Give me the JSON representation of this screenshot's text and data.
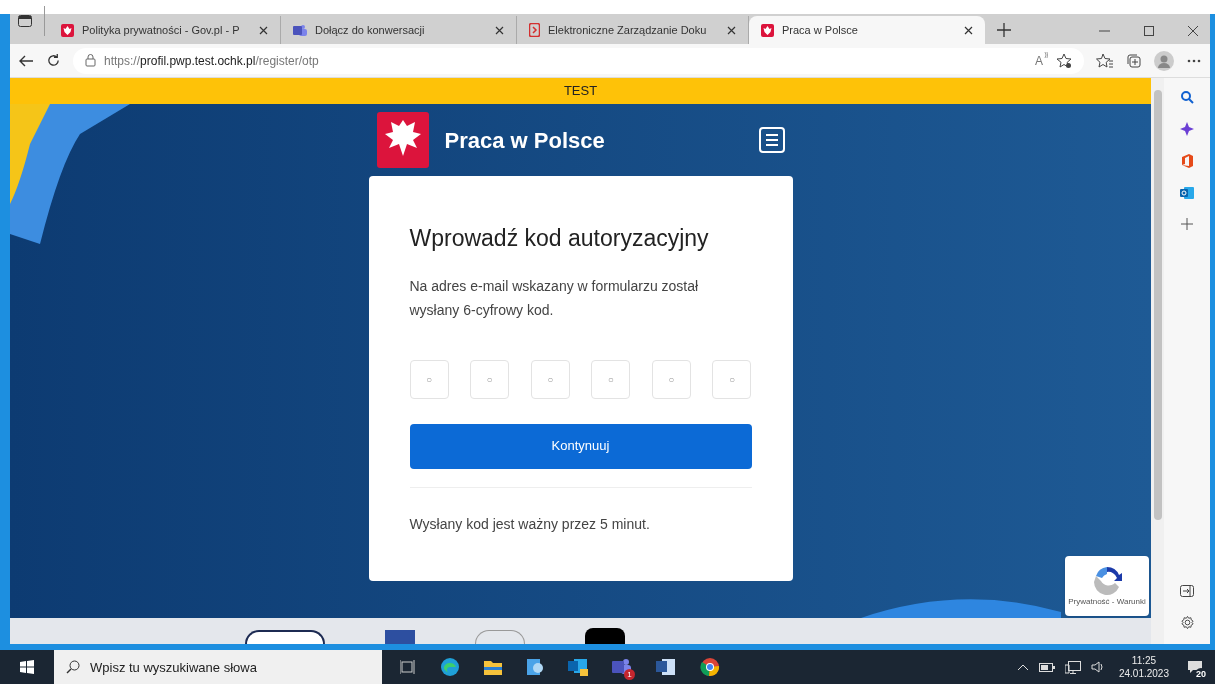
{
  "browser": {
    "tabs": [
      {
        "title": "Polityka prywatności - Gov.pl - P",
        "kind": "eagle",
        "selected": false
      },
      {
        "title": "Dołącz do konwersacji",
        "kind": "teams",
        "selected": false
      },
      {
        "title": "Elektroniczne Zarządzanie Doku",
        "kind": "doc",
        "selected": false
      },
      {
        "title": "Praca w Polsce",
        "kind": "eagle",
        "selected": true
      }
    ],
    "address": {
      "host_prefix": "https://",
      "host": "profil.pwp.test.ochk.pl",
      "path": "/register/otp",
      "read_aloud": "A"
    }
  },
  "page": {
    "banner": "TEST",
    "header": {
      "title": "Praca w Polsce"
    },
    "card": {
      "title": "Wprowadź kod autoryzacyjny",
      "description": "Na adres e-mail wskazany w formularzu został wysłany 6-cyfrowy kod.",
      "code_fields": [
        {
          "placeholder": "○"
        },
        {
          "placeholder": "○"
        },
        {
          "placeholder": "○"
        },
        {
          "placeholder": "○"
        },
        {
          "placeholder": "○"
        },
        {
          "placeholder": "○"
        }
      ],
      "button": "Kontynuuj",
      "note": "Wysłany kod jest ważny przez 5 minut."
    },
    "recaptcha": {
      "links": "Prywatność - Warunki"
    }
  },
  "taskbar": {
    "search": {
      "placeholder": "Wpisz tu wyszukiwane słowa"
    },
    "teams_badge": "1",
    "time": "11:25",
    "date": "24.01.2023",
    "notifications": "20"
  }
}
